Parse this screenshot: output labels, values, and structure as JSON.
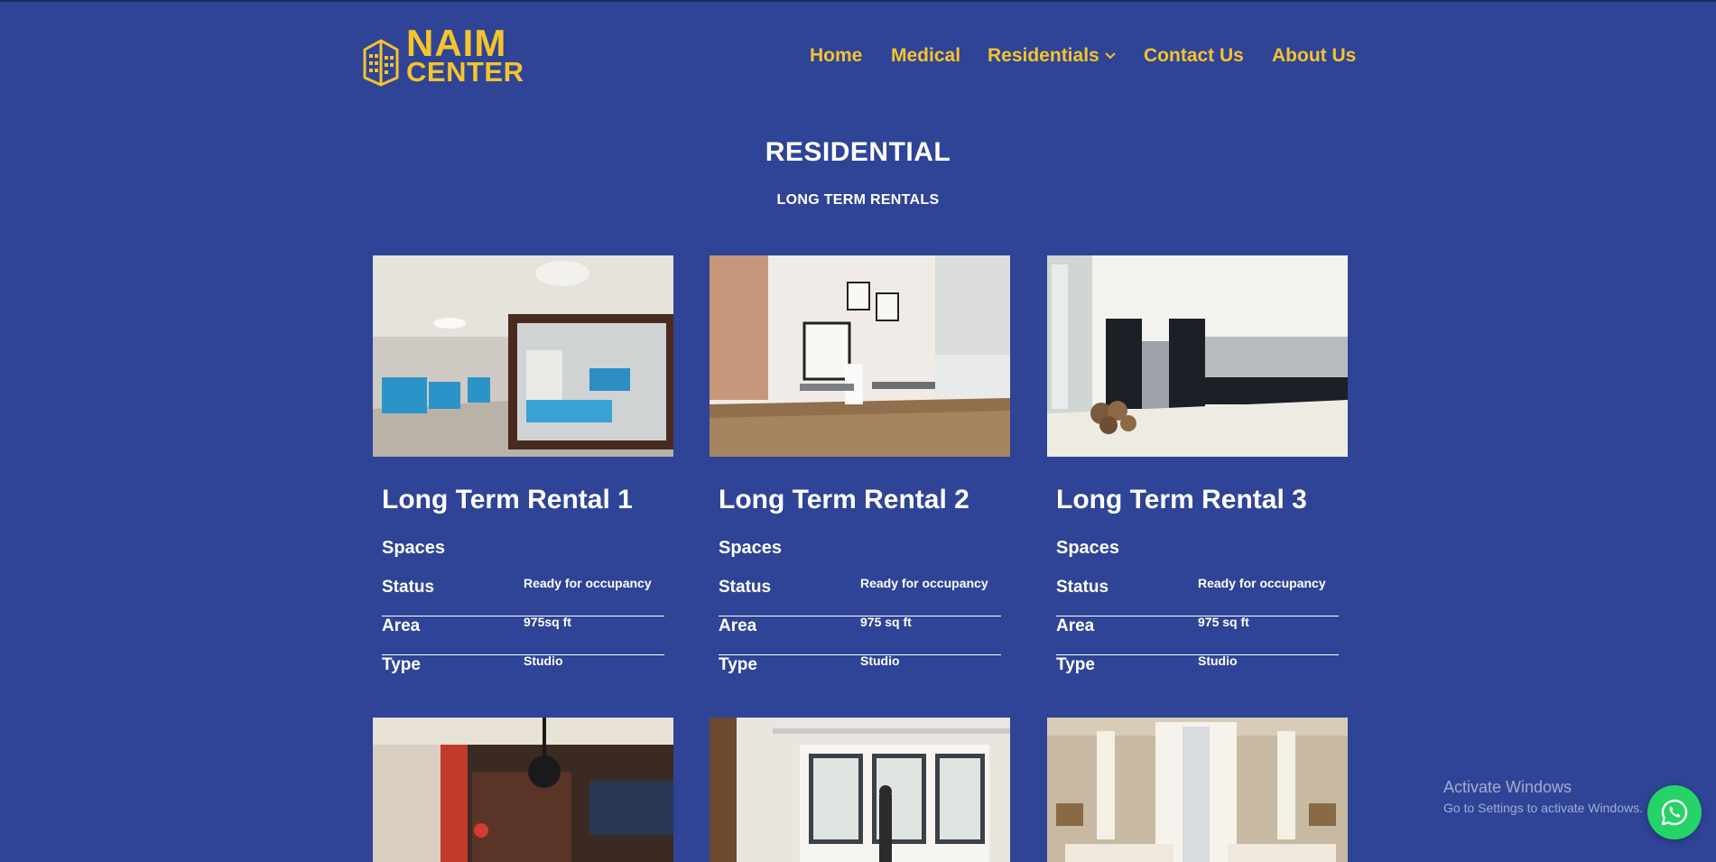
{
  "header": {
    "logo_line1": "NAIM",
    "logo_line2": "CENTER",
    "nav": [
      {
        "label": "Home"
      },
      {
        "label": "Medical"
      },
      {
        "label": "Residentials"
      },
      {
        "label": "Contact Us"
      },
      {
        "label": "About Us"
      }
    ]
  },
  "main": {
    "title": "RESIDENTIAL",
    "subtitle": "LONG TERM RENTALS",
    "cards": [
      {
        "title": "Long Term Rental 1",
        "spaces_label": "Spaces",
        "specs": [
          {
            "label": "Status",
            "value": "Ready for occupancy"
          },
          {
            "label": "Area",
            "value": "975sq ft"
          },
          {
            "label": "Type",
            "value": "Studio"
          }
        ]
      },
      {
        "title": "Long Term Rental 2",
        "spaces_label": "Spaces",
        "specs": [
          {
            "label": "Status",
            "value": "Ready for occupancy"
          },
          {
            "label": "Area",
            "value": "975 sq ft"
          },
          {
            "label": "Type",
            "value": "Studio"
          }
        ]
      },
      {
        "title": "Long Term Rental 3",
        "spaces_label": "Spaces",
        "specs": [
          {
            "label": "Status",
            "value": "Ready for occupancy"
          },
          {
            "label": "Area",
            "value": "975 sq ft"
          },
          {
            "label": "Type",
            "value": "Studio"
          }
        ]
      }
    ]
  },
  "watermark": {
    "line1": "Activate Windows",
    "line2": "Go to Settings to activate Windows."
  },
  "colors": {
    "background": "#2f4496",
    "accent": "#f5c32c",
    "whatsapp": "#25d366"
  },
  "icons": {
    "logo": "building-icon",
    "dropdown": "chevron-down-icon",
    "chat": "whatsapp-icon"
  }
}
